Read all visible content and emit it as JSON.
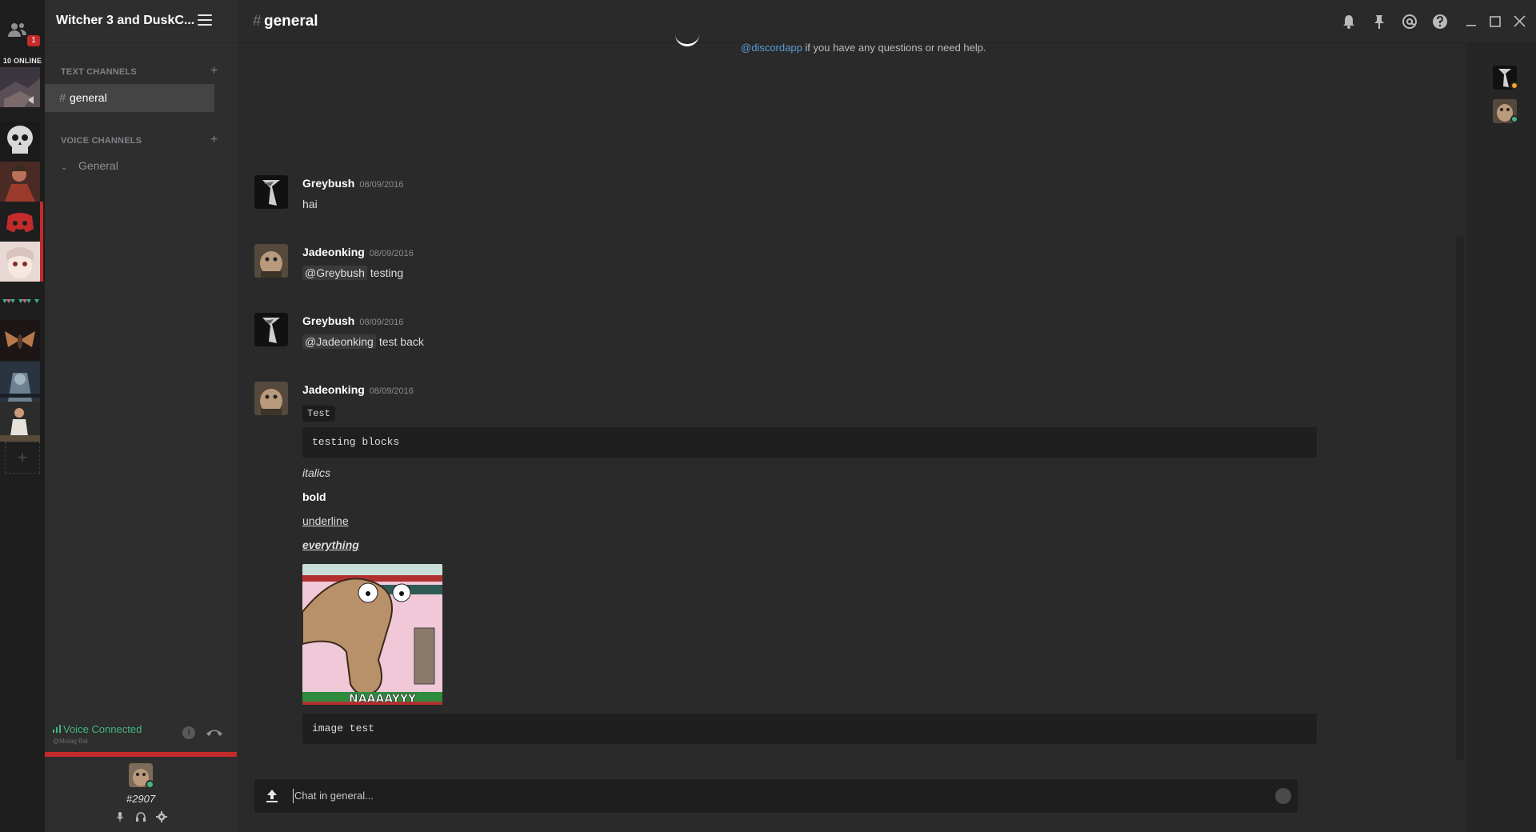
{
  "server_rail": {
    "online_count": "10 ONLINE",
    "friends_badge": "1",
    "friends_icon": "friends-icon",
    "add_server_glyph": "+"
  },
  "guild": {
    "name": "Witcher 3 and DuskC...",
    "text_channels_label": "TEXT CHANNELS",
    "voice_channels_label": "VOICE CHANNELS",
    "active_channel": "general",
    "voice_channel": "General"
  },
  "voice_status": {
    "title": "Voice Connected",
    "subtitle": "@Molag Bal",
    "info_glyph": "i"
  },
  "user": {
    "discriminator": "#2907"
  },
  "header": {
    "channel": "general",
    "hash": "#"
  },
  "intro": {
    "mention": "@discordapp",
    "text": " if you have any questions or need help."
  },
  "messages": [
    {
      "author": "Greybush",
      "timestamp": "08/09/2016",
      "text": "hai"
    },
    {
      "author": "Jadeonking",
      "timestamp": "08/09/2016",
      "mention": "@Greybush",
      "text": "testing"
    },
    {
      "author": "Greybush",
      "timestamp": "08/09/2016",
      "mention": "@Jadeonking",
      "text": "test back"
    },
    {
      "author": "Jadeonking",
      "timestamp": "08/09/2016",
      "inline_code": "Test",
      "code_block": "testing blocks",
      "italics": "italics",
      "bold": "bold",
      "underline": "underline",
      "everything": "everything",
      "image_caption": "NAAAAYYY",
      "code_block_2": "image test"
    }
  ],
  "composer": {
    "placeholder": "Chat in general..."
  },
  "colors": {
    "accent_red": "#c42b2b",
    "voice_green": "#43b581",
    "idle_orange": "#faa61a"
  }
}
